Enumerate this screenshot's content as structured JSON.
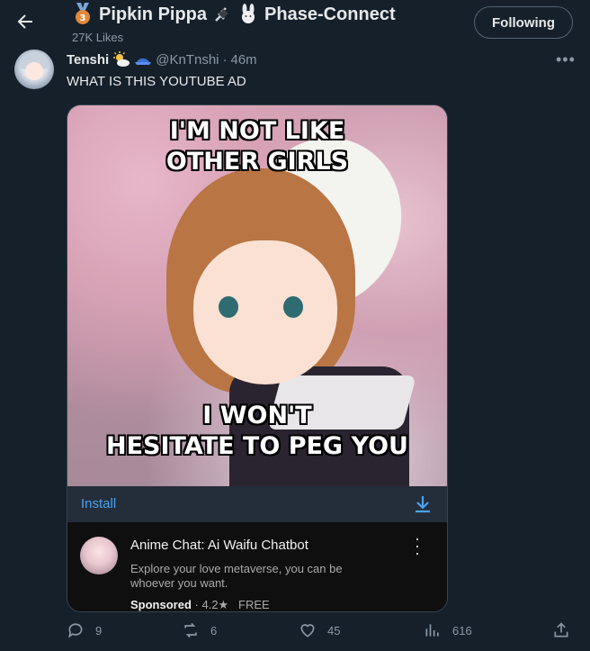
{
  "header": {
    "title_left": "Pipkin Pippa",
    "title_right": "Phase-Connect",
    "likes": "27K Likes",
    "follow_label": "Following"
  },
  "tweet": {
    "author_name": "Tenshi",
    "handle": "@KnTnshi",
    "separator": "·",
    "time": "46m",
    "text": "WHAT IS THIS YOUTUBE AD"
  },
  "media": {
    "caption_top_line1": "I'M NOT LIKE",
    "caption_top_line2": "OTHER GIRLS",
    "caption_bottom_line1": "I WON'T",
    "caption_bottom_line2": "HESITATE TO PEG YOU",
    "install_label": "Install"
  },
  "ad": {
    "app_name": "Anime Chat: Ai Waifu Chatbot",
    "description": "Explore your love metaverse, you can be whoever you want.",
    "sponsored": "Sponsored",
    "rating": "· 4.2★",
    "price": "FREE"
  },
  "actions": {
    "replies": "9",
    "retweets": "6",
    "likes": "45",
    "views": "616"
  },
  "colors": {
    "background": "#15202b",
    "accent": "#1d9bf0",
    "muted": "#8b98a5"
  },
  "icons": [
    "back-arrow-icon",
    "medal-icon",
    "plug-icon",
    "bunny-icon",
    "sun-cloud-icon",
    "cap-icon",
    "more-icon",
    "download-icon",
    "reply-icon",
    "retweet-icon",
    "like-icon",
    "views-icon",
    "share-icon"
  ]
}
